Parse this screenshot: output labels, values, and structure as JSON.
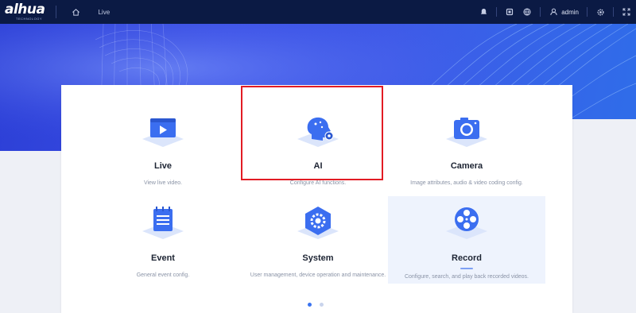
{
  "brand": {
    "name": "alhua",
    "tagline": "TECHNOLOGY"
  },
  "header": {
    "nav_label": "Live",
    "username": "admin",
    "icons": [
      "bell-icon",
      "device-icon",
      "globe-icon",
      "user-icon",
      "gear-icon",
      "fullscreen-icon"
    ]
  },
  "tiles": [
    {
      "title": "Live",
      "desc": "View live video.",
      "icon": "play-screen-icon"
    },
    {
      "title": "AI",
      "desc": "Configure AI functions.",
      "icon": "ai-head-icon"
    },
    {
      "title": "Camera",
      "desc": "Image attributes, audio & video coding config.",
      "icon": "camera-icon"
    },
    {
      "title": "Event",
      "desc": "General event config.",
      "icon": "clipboard-icon"
    },
    {
      "title": "System",
      "desc": "User management, device operation and maintenance.",
      "icon": "system-gear-icon"
    },
    {
      "title": "Record",
      "desc": "Configure, search, and play back recorded videos.",
      "icon": "film-reel-icon"
    }
  ],
  "highlighted_tile": "AI",
  "selected_tile": "Record",
  "pager": {
    "pages": 2,
    "current": 1
  },
  "colors": {
    "topbar": "#0b1a44",
    "accent": "#3b74f0",
    "highlight": "#e21c24",
    "hero": "#3a4fe6"
  }
}
